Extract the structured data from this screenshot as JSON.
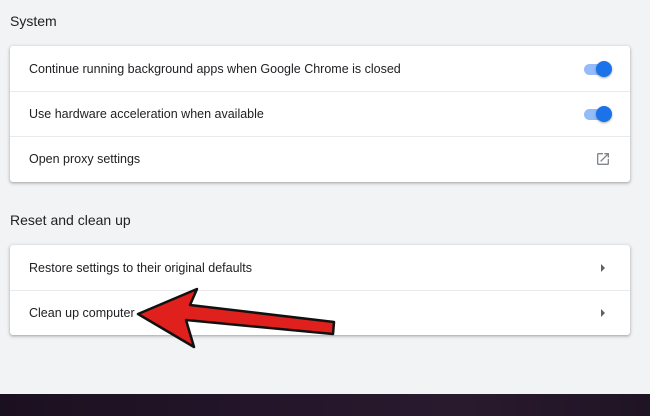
{
  "sections": {
    "system": {
      "title": "System",
      "rows": [
        {
          "label": "Continue running background apps when Google Chrome is closed",
          "toggle_on": true
        },
        {
          "label": "Use hardware acceleration when available",
          "toggle_on": true
        },
        {
          "label": "Open proxy settings",
          "icon": "external-link-icon"
        }
      ]
    },
    "reset": {
      "title": "Reset and clean up",
      "rows": [
        {
          "label": "Restore settings to their original defaults",
          "icon": "chevron-right-icon"
        },
        {
          "label": "Clean up computer",
          "icon": "chevron-right-icon"
        }
      ]
    }
  },
  "annotation": {
    "icon": "red-arrow-icon",
    "color": "#e0201c"
  },
  "colors": {
    "toggle_knob": "#1a73e8",
    "toggle_track": "#8ab4f8",
    "background": "#f1f3f4"
  }
}
